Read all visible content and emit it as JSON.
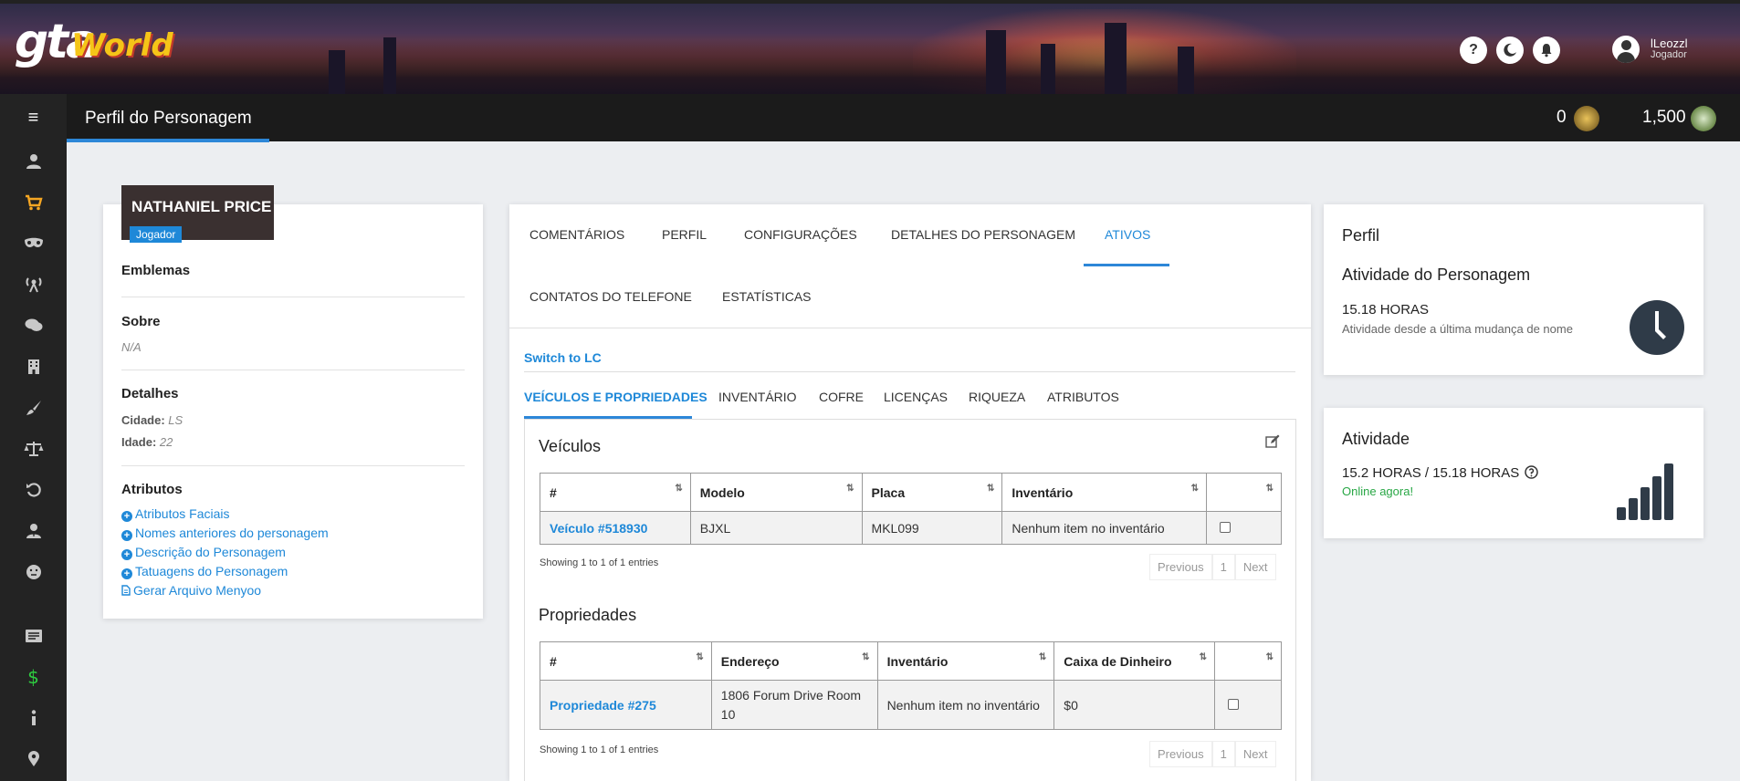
{
  "header": {
    "logo_gta": "gta",
    "logo_world": "World",
    "help_icon": "?",
    "user_name": "lLeozzl",
    "user_role": "Jogador"
  },
  "topbar": {
    "menu_icon": "≡",
    "page_title": "Perfil do Personagem",
    "coins_a": "0",
    "coins_b": "1,500"
  },
  "sidebar": {
    "items": [
      "user-icon",
      "shopping-cart-icon",
      "mask-icon",
      "broadcast-icon",
      "comments-icon",
      "building-icon",
      "paint-brush-icon",
      "balance-scale-icon",
      "history-icon",
      "user-tie-icon",
      "face-icon",
      "news-icon",
      "dollar-icon",
      "info-icon",
      "map-marker-icon"
    ],
    "active": "shopping-cart-icon"
  },
  "character": {
    "name": "NATHANIEL PRICE",
    "role": "Jogador",
    "emblems_heading": "Emblemas",
    "about_heading": "Sobre",
    "about_value": "N/A",
    "details_heading": "Detalhes",
    "city_label": "Cidade:",
    "city_value": "LS",
    "age_label": "Idade:",
    "age_value": "22",
    "attributes_heading": "Atributos",
    "links": [
      "Atributos Faciais",
      "Nomes anteriores do personagem",
      "Descrição do Personagem",
      "Tatuagens do Personagem",
      "Gerar Arquivo Menyoo"
    ]
  },
  "main_tabs": {
    "row1": [
      "COMENTÁRIOS",
      "PERFIL",
      "CONFIGURAÇÕES",
      "DETALHES DO PERSONAGEM",
      "ATIVOS"
    ],
    "row2": [
      "CONTATOS DO TELEFONE",
      "ESTATÍSTICAS"
    ],
    "active": "ATIVOS"
  },
  "assets": {
    "switch_link": "Switch to LC",
    "subtabs": [
      "VEÍCULOS E PROPRIEDADES",
      "INVENTÁRIO",
      "COFRE",
      "LICENÇAS",
      "RIQUEZA",
      "ATRIBUTOS"
    ],
    "active_subtab": "VEÍCULOS E PROPRIEDADES",
    "vehicles_title": "Veículos",
    "vehicles_columns": [
      "#",
      "Modelo",
      "Placa",
      "Inventário",
      ""
    ],
    "vehicles_rows": [
      {
        "id": "Veículo #518930",
        "model": "BJXL",
        "plate": "MKL099",
        "inventory": "Nenhum item no inventário"
      }
    ],
    "vehicles_showing": "Showing 1 to 1 of 1 entries",
    "properties_title": "Propriedades",
    "properties_columns": [
      "#",
      "Endereço",
      "Inventário",
      "Caixa de Dinheiro",
      ""
    ],
    "properties_rows": [
      {
        "id": "Propriedade #275",
        "address_line1": "1806 Forum Drive Room",
        "address_line2": "10",
        "inventory": "Nenhum item no inventário",
        "cash": "$0"
      }
    ],
    "properties_showing": "Showing 1 to 1 of 1 entries",
    "pager": {
      "prev": "Previous",
      "page": "1",
      "next": "Next"
    }
  },
  "profile_card": {
    "title": "Perfil",
    "activity_title": "Atividade do Personagem",
    "hours": "15.18 HORAS",
    "since": "Atividade desde a última mudança de nome"
  },
  "activity_card": {
    "title": "Atividade",
    "hours": "15.2 HORAS / 15.18 HORAS",
    "online": "Online agora!"
  },
  "colors": {
    "accent": "#2d87d8",
    "sidebar_bg": "#232323",
    "active_icon": "#f5a623",
    "online": "#28a745"
  }
}
